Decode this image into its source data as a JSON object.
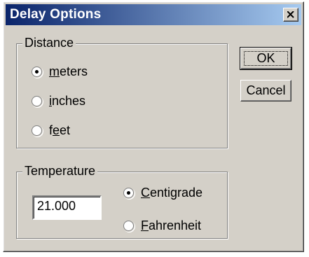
{
  "window": {
    "title": "Delay Options"
  },
  "distance": {
    "legend": "Distance",
    "options": [
      {
        "label_underline": "m",
        "label_rest": "eters",
        "selected": true
      },
      {
        "label_underline": "i",
        "label_rest": "nches",
        "selected": false
      },
      {
        "label_prefix": "f",
        "label_underline": "e",
        "label_rest": "et",
        "selected": false
      }
    ]
  },
  "temperature": {
    "legend": "Temperature",
    "value": "21.000",
    "options": [
      {
        "label_underline": "C",
        "label_rest": "entigrade",
        "selected": true
      },
      {
        "label_underline": "F",
        "label_rest": "ahrenheit",
        "selected": false
      }
    ]
  },
  "buttons": {
    "ok": "OK",
    "cancel": "Cancel"
  }
}
